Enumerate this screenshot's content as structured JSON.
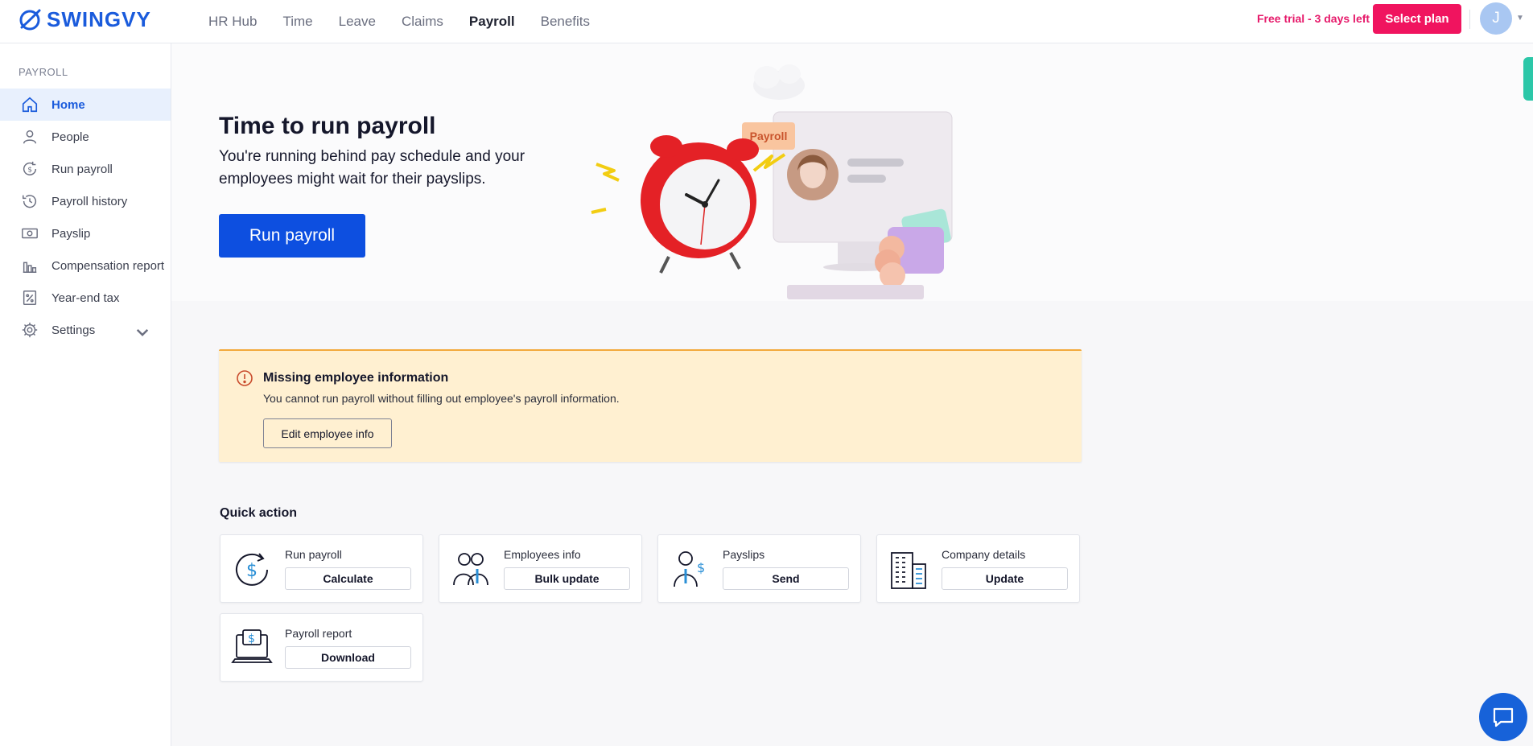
{
  "brand": {
    "name": "SWINGVY"
  },
  "topnav": {
    "items": [
      "HR Hub",
      "Time",
      "Leave",
      "Claims",
      "Payroll",
      "Benefits"
    ],
    "active": "Payroll"
  },
  "account": {
    "trial_text": "Free trial - 3 days left",
    "select_plan_label": "Select plan",
    "avatar_initial": "J"
  },
  "sidebar": {
    "heading": "PAYROLL",
    "items": [
      {
        "label": "Home",
        "icon": "home-icon",
        "active": true
      },
      {
        "label": "People",
        "icon": "person-icon"
      },
      {
        "label": "Run payroll",
        "icon": "dollar-refresh-icon"
      },
      {
        "label": "Payroll history",
        "icon": "history-icon"
      },
      {
        "label": "Payslip",
        "icon": "banknote-icon"
      },
      {
        "label": "Compensation report",
        "icon": "bar-chart-icon"
      },
      {
        "label": "Year-end tax",
        "icon": "percent-doc-icon"
      },
      {
        "label": "Settings",
        "icon": "gear-icon",
        "expandable": true
      }
    ]
  },
  "hero": {
    "title": "Time to run payroll",
    "subtitle": "You're running behind pay schedule and your employees might wait for their payslips.",
    "button_label": "Run payroll",
    "illustration_tag": "Payroll"
  },
  "alert": {
    "title": "Missing employee information",
    "text": "You cannot run payroll without filling out employee's payroll information.",
    "button_label": "Edit employee info"
  },
  "quick_action": {
    "title": "Quick action",
    "cards": [
      {
        "label": "Run payroll",
        "button": "Calculate",
        "icon": "dollar-cycle-icon"
      },
      {
        "label": "Employees info",
        "button": "Bulk update",
        "icon": "employees-icon"
      },
      {
        "label": "Payslips",
        "button": "Send",
        "icon": "payslip-person-icon"
      },
      {
        "label": "Company details",
        "button": "Update",
        "icon": "building-icon"
      },
      {
        "label": "Payroll report",
        "button": "Download",
        "icon": "laptop-report-icon"
      }
    ]
  },
  "colors": {
    "brand_blue": "#1a5bdc",
    "primary_button": "#0d4fe0",
    "trial_pink": "#e6196a",
    "alert_bg": "#fff0d1",
    "alert_border": "#f3a93c"
  }
}
